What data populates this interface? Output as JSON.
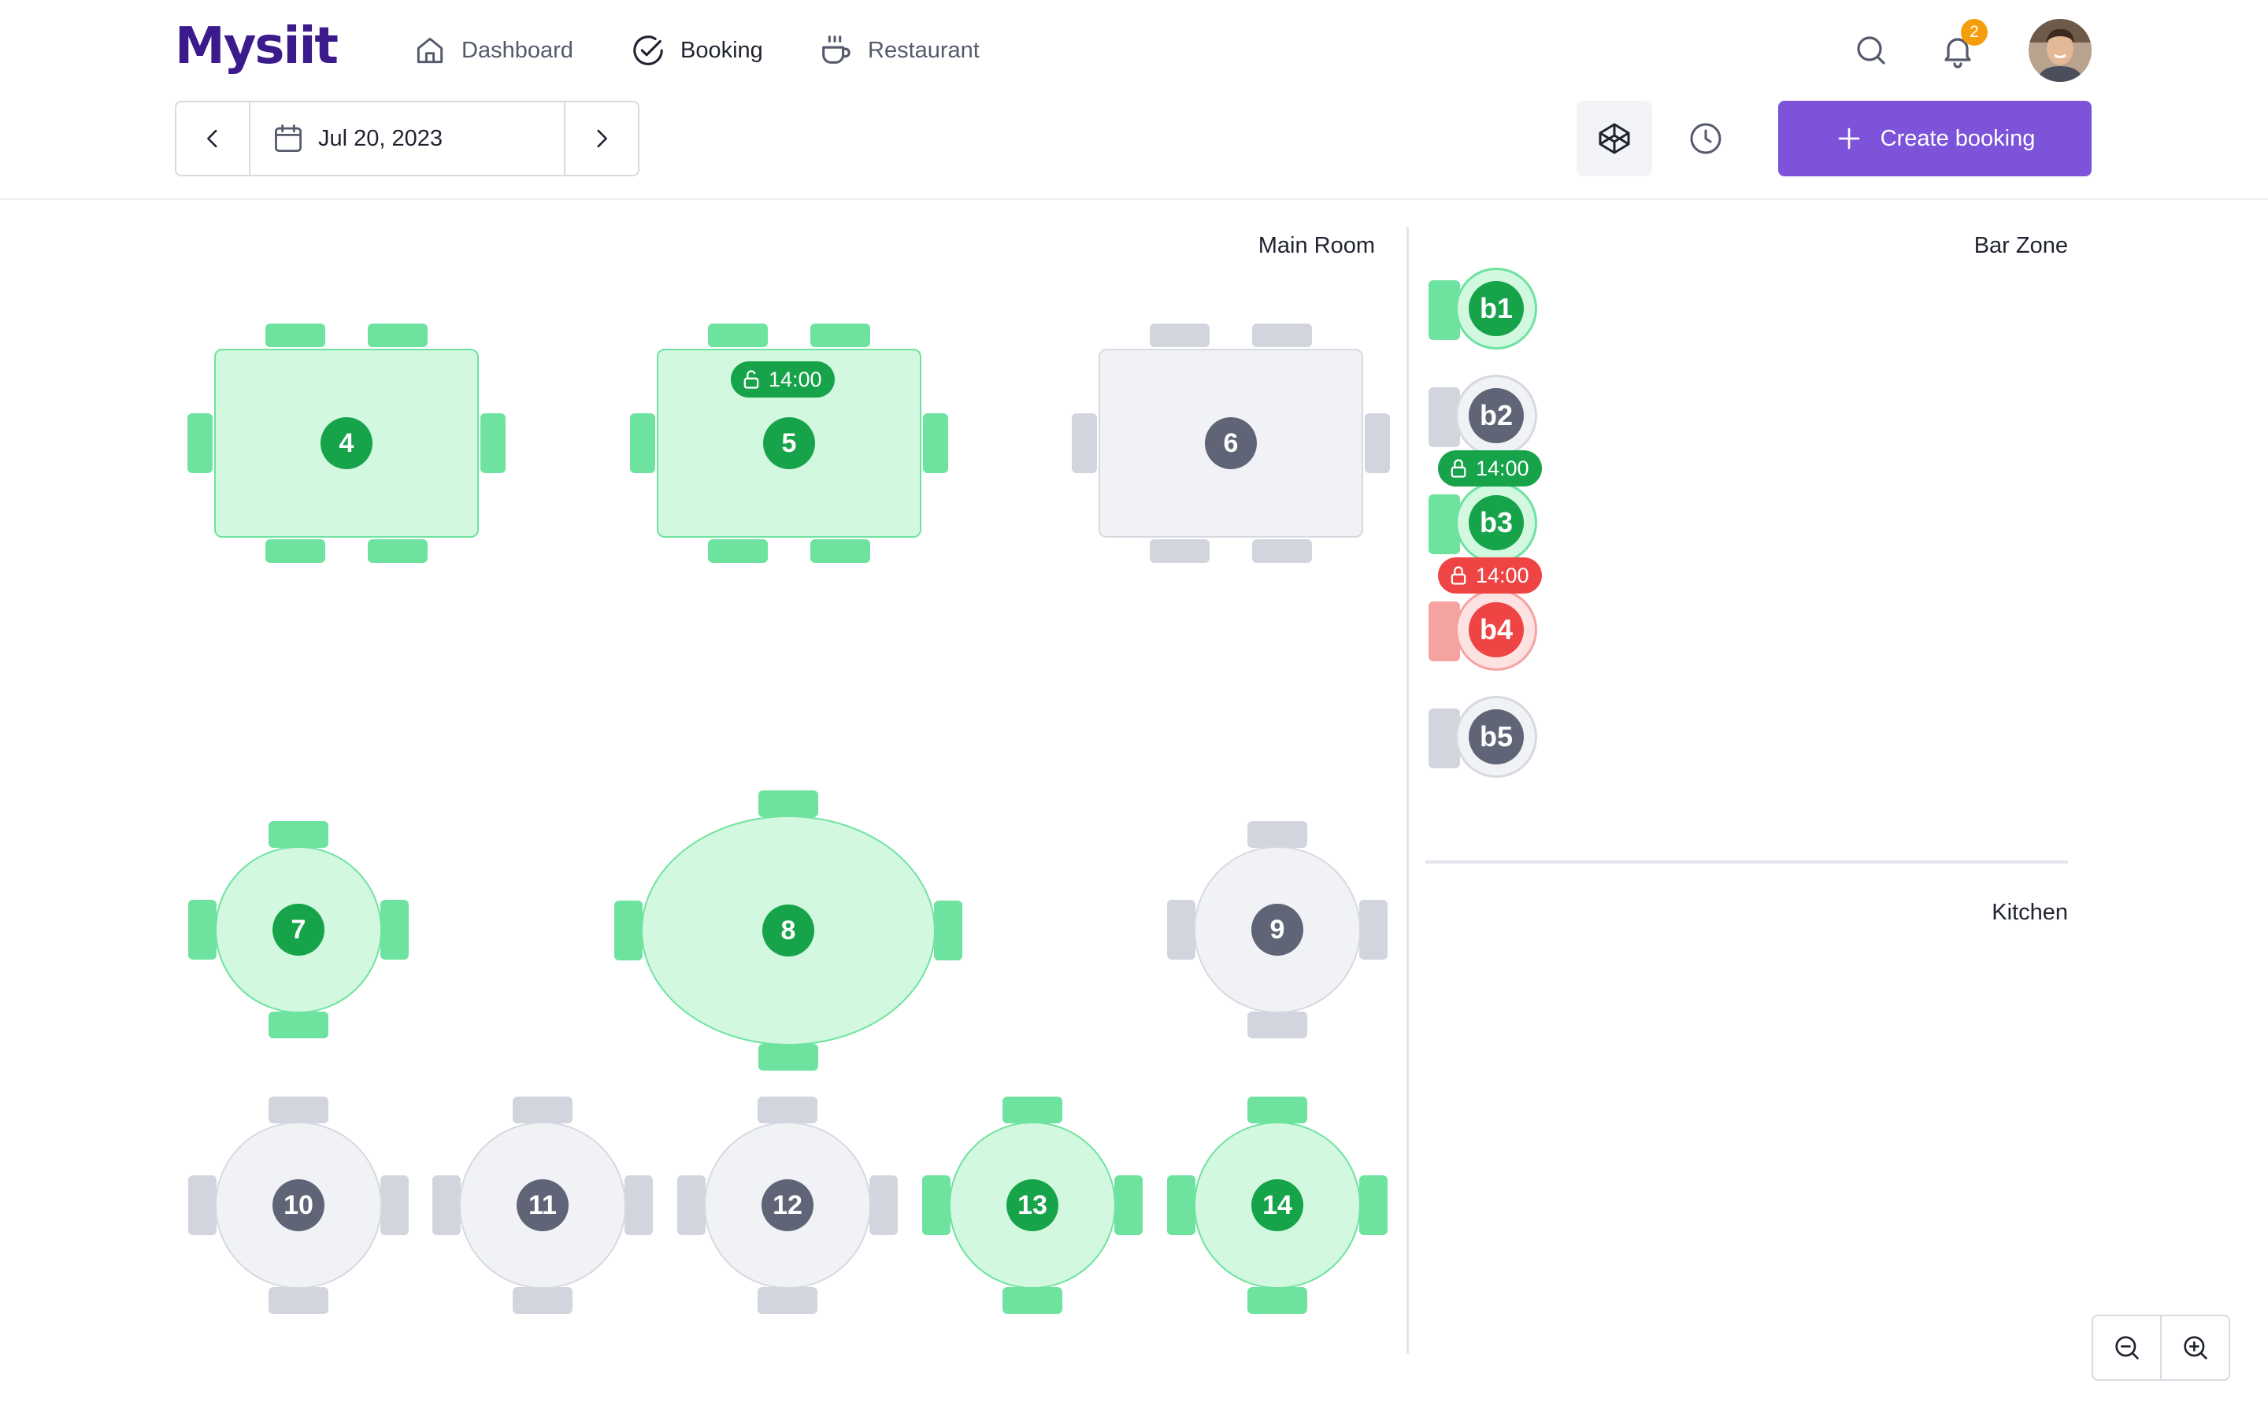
{
  "app": {
    "name": "Mysiit"
  },
  "nav": {
    "dashboard": "Dashboard",
    "booking": "Booking",
    "restaurant": "Restaurant"
  },
  "notifications": {
    "count": "2"
  },
  "date_picker": {
    "value": "Jul 20, 2023"
  },
  "actions": {
    "create_booking": "Create booking"
  },
  "zones": {
    "main_room": "Main Room",
    "bar_zone": "Bar Zone",
    "kitchen": "Kitchen"
  },
  "colors": {
    "available": "#16a34a",
    "unavailable": "#5f6577",
    "locked": "#ef4444",
    "brand": "#3b1a8c",
    "accent": "#7c53d9"
  },
  "main_tables": [
    {
      "id": "4",
      "status": "available",
      "shape": "rect"
    },
    {
      "id": "5",
      "status": "available",
      "shape": "rect",
      "lock": "14:00"
    },
    {
      "id": "6",
      "status": "unavailable",
      "shape": "rect"
    },
    {
      "id": "7",
      "status": "available",
      "shape": "round"
    },
    {
      "id": "8",
      "status": "available",
      "shape": "oval"
    },
    {
      "id": "9",
      "status": "unavailable",
      "shape": "round"
    },
    {
      "id": "10",
      "status": "unavailable",
      "shape": "round"
    },
    {
      "id": "11",
      "status": "unavailable",
      "shape": "round"
    },
    {
      "id": "12",
      "status": "unavailable",
      "shape": "round"
    },
    {
      "id": "13",
      "status": "available",
      "shape": "round"
    },
    {
      "id": "14",
      "status": "available",
      "shape": "round"
    }
  ],
  "bar_seats": [
    {
      "id": "b1",
      "status": "available"
    },
    {
      "id": "b2",
      "status": "unavailable"
    },
    {
      "id": "b3",
      "status": "available",
      "lock": "14:00"
    },
    {
      "id": "b4",
      "status": "locked",
      "lock": "14:00"
    },
    {
      "id": "b5",
      "status": "unavailable"
    }
  ]
}
